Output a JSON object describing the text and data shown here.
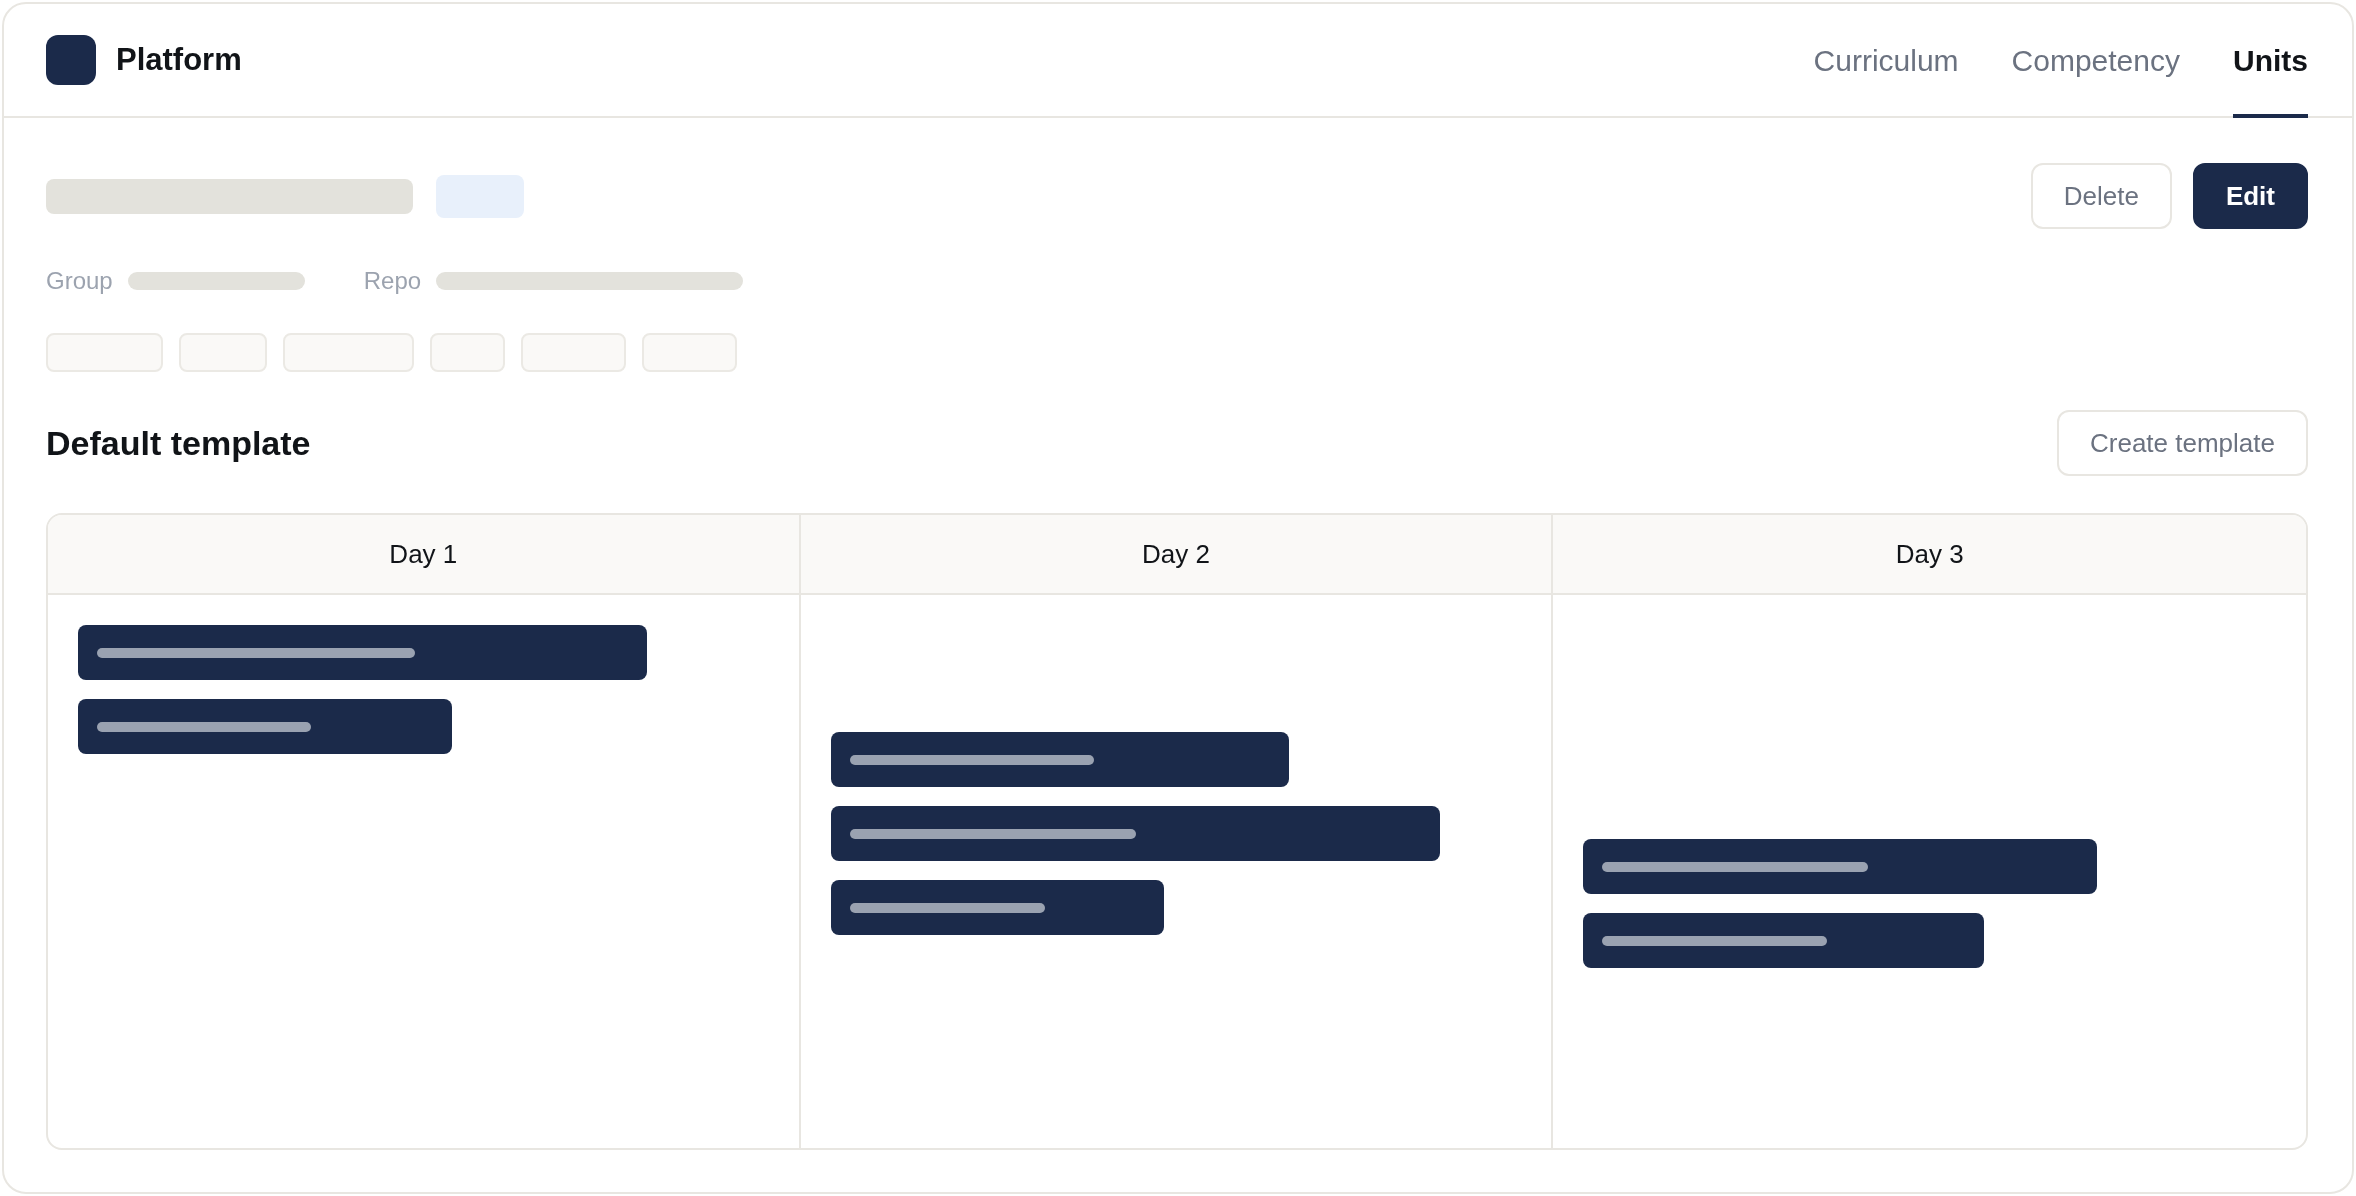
{
  "app": {
    "name": "Platform"
  },
  "tabs": [
    {
      "label": "Curriculum",
      "selected": false
    },
    {
      "label": "Competency",
      "selected": false
    },
    {
      "label": "Units",
      "selected": true
    }
  ],
  "unit": {
    "title": {
      "kind": "skeleton"
    },
    "badge": {
      "kind": "skeleton"
    },
    "fields": [
      {
        "label": "Group",
        "value": {
          "kind": "skeleton"
        }
      },
      {
        "label": "Repo",
        "value": {
          "kind": "skeleton"
        }
      }
    ],
    "tags": [
      {
        "kind": "skeleton"
      },
      {
        "kind": "skeleton"
      },
      {
        "kind": "skeleton"
      },
      {
        "kind": "skeleton"
      },
      {
        "kind": "skeleton"
      },
      {
        "kind": "skeleton"
      }
    ]
  },
  "actions": [
    {
      "label": "Delete",
      "kind": "delete"
    },
    {
      "label": "Edit",
      "kind": "edit"
    }
  ],
  "template": {
    "title": "Default template",
    "action": {
      "label": "Create template"
    },
    "days": [
      {
        "label": "Day 1",
        "units": [
          {
            "kind": "skeleton"
          },
          {
            "kind": "skeleton"
          }
        ]
      },
      {
        "label": "Day 2",
        "units": [
          {
            "kind": "skeleton"
          },
          {
            "kind": "skeleton"
          },
          {
            "kind": "skeleton"
          }
        ]
      },
      {
        "label": "Day 3",
        "units": [
          {
            "kind": "skeleton"
          },
          {
            "kind": "skeleton"
          }
        ]
      }
    ]
  }
}
